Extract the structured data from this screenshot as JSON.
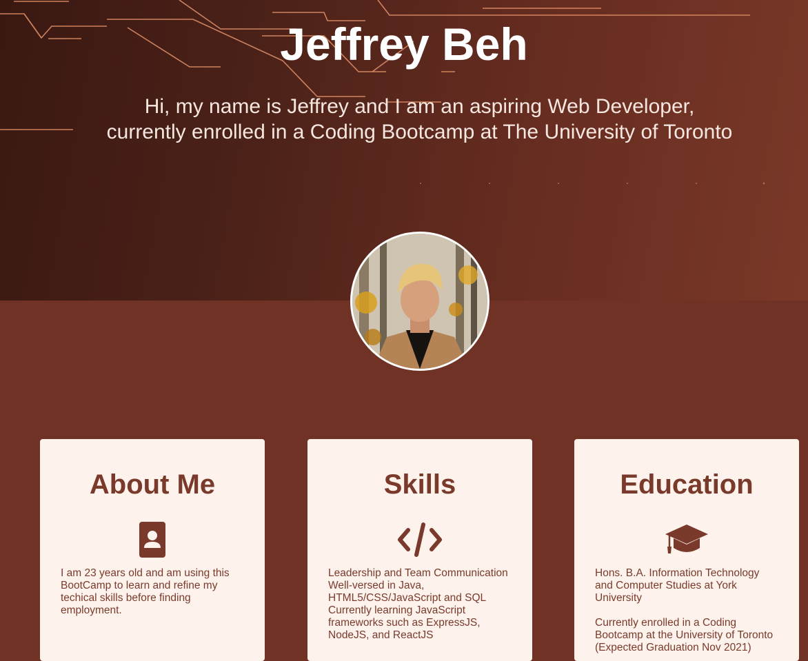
{
  "hero": {
    "title": "Jeffrey Beh",
    "intro_line1": "Hi, my name is Jeffrey and I am an aspiring Web Developer,",
    "intro_line2": "currently enrolled in a Coding Bootcamp at The University of Toronto"
  },
  "profile": {
    "photo_alt": "Jeffrey Beh profile photo"
  },
  "cards": {
    "about": {
      "title": "About Me",
      "icon": "contact-card-icon",
      "text": "I am 23 years old and am using this BootCamp to learn and refine my techical skills before finding employment."
    },
    "skills": {
      "title": "Skills",
      "icon": "code-icon",
      "line1": "Leadership and Team Communication",
      "line2": "Well-versed in Java, HTML5/CSS/JavaScript and SQL",
      "line3": "Currently learning JavaScript frameworks such as ExpressJS, NodeJS, and ReactJS"
    },
    "education": {
      "title": "Education",
      "icon": "graduation-cap-icon",
      "line1": "Hons. B.A. Information Technology and Computer Studies at York University",
      "line2": "Currently enrolled in a Coding Bootcamp at the University of Toronto (Expected Graduation Nov 2021)"
    }
  },
  "colors": {
    "accent": "#7a3a2b",
    "card_bg": "#fdf3ec",
    "page_bg": "#6f3224"
  }
}
